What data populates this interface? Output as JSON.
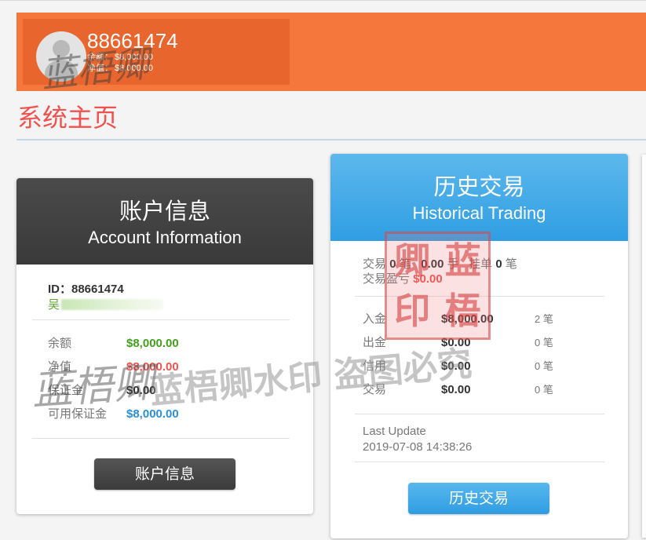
{
  "header": {
    "account_id": "88661474",
    "balance_label": "余额：",
    "balance_value": "$8,000.00",
    "equity_label": "净值：",
    "equity_value": "$8,000.00"
  },
  "page": {
    "title": "系统主页"
  },
  "account_card": {
    "title_cn": "账户信息",
    "title_en": "Account Information",
    "id_text": "ID：88661474",
    "name_prefix": "吴",
    "rows": [
      {
        "label": "余额",
        "value": "$8,000.00",
        "color": "#44a01b"
      },
      {
        "label": "净值",
        "value": "$8,000.00",
        "color": "#f0524e"
      },
      {
        "label": "保证金",
        "value": "$0.00",
        "color": "#333333"
      },
      {
        "label": "可用保证金",
        "value": "$8,000.00",
        "color": "#2b8fd8"
      }
    ],
    "button_label": "账户信息"
  },
  "history_card": {
    "title_cn": "历史交易",
    "title_en": "Historical Trading",
    "summary": {
      "trade_label": "交易",
      "trade_count": "0",
      "unit_bi": "笔",
      "lots": "0.00",
      "unit_shou": "手",
      "pending_label": "挂单",
      "pending_count": "0",
      "pnl_label": "交易盈亏",
      "pnl_value": "$0.00"
    },
    "rows": [
      {
        "label": "入金",
        "value": "$8,000.00",
        "count": "2 笔"
      },
      {
        "label": "出金",
        "value": "$0.00",
        "count": "0 笔"
      },
      {
        "label": "信用",
        "value": "$0.00",
        "count": "0 笔"
      },
      {
        "label": "交易",
        "value": "$0.00",
        "count": "0 笔"
      }
    ],
    "last_update_label": "Last Update",
    "last_update_value": "2019-07-08 14:38:26",
    "button_label": "历史交易"
  },
  "watermark": {
    "seal_chars": [
      "卿",
      "蓝",
      "印",
      "梧"
    ],
    "signature": "蓝梧卿",
    "text": "蓝梧卿水印 盗图必究"
  },
  "colors": {
    "banner": "#f6773c",
    "title": "#f0524e",
    "dark_header": "#3a3a3a",
    "blue_header": "#2f9ee3"
  }
}
